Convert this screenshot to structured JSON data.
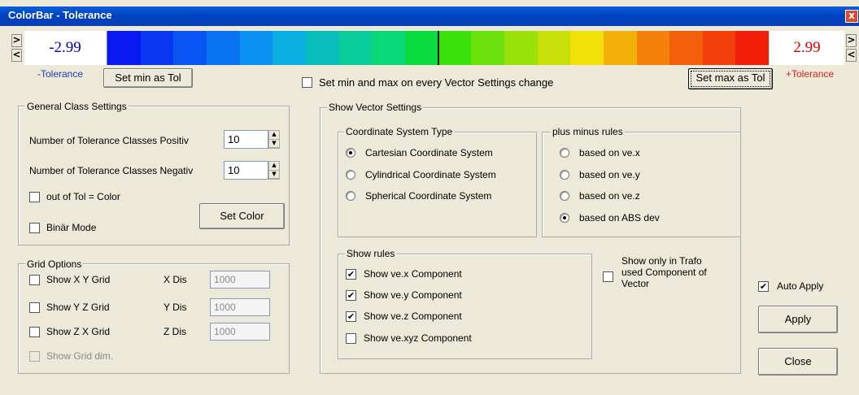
{
  "window": {
    "title": "ColorBar - Tolerance",
    "close_label": "x"
  },
  "colorbar": {
    "min_value": "-2.99",
    "max_value": "2.99",
    "left_up": ">",
    "left_down": "<",
    "right_up": ">",
    "right_down": "<",
    "neg_label": "-Tolerance",
    "pos_label": "+Tolerance",
    "set_min_button": "Set min as Tol",
    "set_max_button": "Set max as Tol",
    "colors": [
      "#0A18F2",
      "#0A37F2",
      "#0A55F2",
      "#0A73F2",
      "#0A91F2",
      "#0AAFE0",
      "#0ABDBD",
      "#0ACB9A",
      "#0AD877",
      "#0ADC40",
      "#3AE00A",
      "#6AE00A",
      "#9AE00A",
      "#C8E00A",
      "#F2E00A",
      "#F2B00A",
      "#F2800A",
      "#F2600A",
      "#F2400A",
      "#F2200A"
    ],
    "min_color": "#0000CC",
    "max_color": "#DD0000"
  },
  "set_min_max_checkbox": {
    "label": "Set min and max on every Vector Settings change",
    "checked": false
  },
  "general": {
    "legend": "General Class Settings",
    "pos_label": "Number of Tolerance Classes Positiv",
    "pos_value": "10",
    "neg_label": "Number of Tolerance Classes Negativ",
    "neg_value": "10",
    "out_of_tol_label": "out of Tol = Color",
    "out_of_tol_checked": false,
    "binar_label": "Binär Mode",
    "binar_checked": false,
    "set_color_button": "Set Color"
  },
  "grid": {
    "legend": "Grid Options",
    "rows": [
      {
        "label": "Show X Y Grid",
        "dis_label": "X Dis",
        "value": "1000"
      },
      {
        "label": "Show Y Z Grid",
        "dis_label": "Y Dis",
        "value": "1000"
      },
      {
        "label": "Show Z X Grid",
        "dis_label": "Z Dis",
        "value": "1000"
      }
    ],
    "show_dim_label": "Show Grid dim."
  },
  "vector": {
    "legend": "Show Vector Settings",
    "coord": {
      "legend": "Coordinate System Type",
      "options": [
        "Cartesian Coordinate System",
        "Cylindrical Coordinate System",
        "Spherical Coordinate System"
      ],
      "selected": "Cartesian Coordinate System"
    },
    "plusminus": {
      "legend": "plus minus rules",
      "options": [
        "based on ve.x",
        "based on ve.y",
        "based on ve.z",
        "based on ABS dev"
      ],
      "selected": "based on ABS dev"
    },
    "rules": {
      "legend": "Show rules",
      "items": [
        {
          "label": "Show ve.x Component",
          "checked": true
        },
        {
          "label": "Show ve.y Component",
          "checked": true
        },
        {
          "label": "Show ve.z Component",
          "checked": true
        },
        {
          "label": "Show ve.xyz Component",
          "checked": false
        }
      ]
    },
    "trafo": {
      "line1": "Show only in Trafo",
      "line2": "used Component of",
      "line3": "Vector",
      "checked": false
    }
  },
  "auto_apply": {
    "label": "Auto Apply",
    "checked": true
  },
  "apply_button": "Apply",
  "close_button": "Close",
  "check_mark": "✔"
}
